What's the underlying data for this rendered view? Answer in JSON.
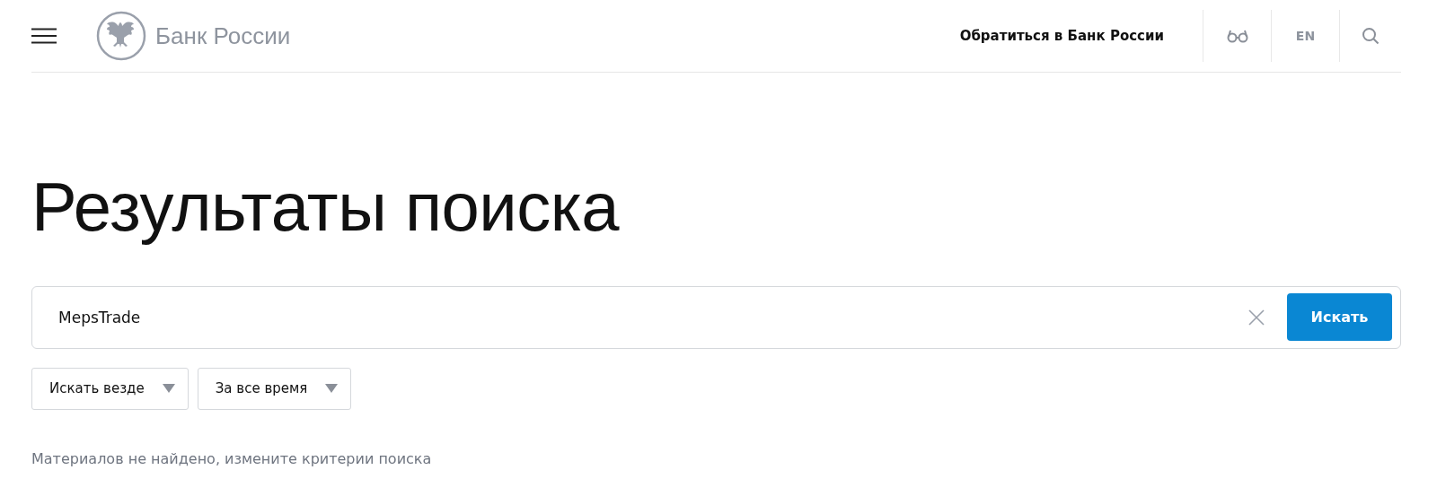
{
  "header": {
    "logo_text": "Банк России",
    "contact_link": "Обратиться в Банк России",
    "language": "EN"
  },
  "title": "Результаты поиска",
  "search": {
    "value": "MepsTrade",
    "button": "Искать"
  },
  "filters": [
    {
      "label": "Искать везде"
    },
    {
      "label": "За все время"
    }
  ],
  "message": "Материалов не найдено, измените критерии поиска"
}
